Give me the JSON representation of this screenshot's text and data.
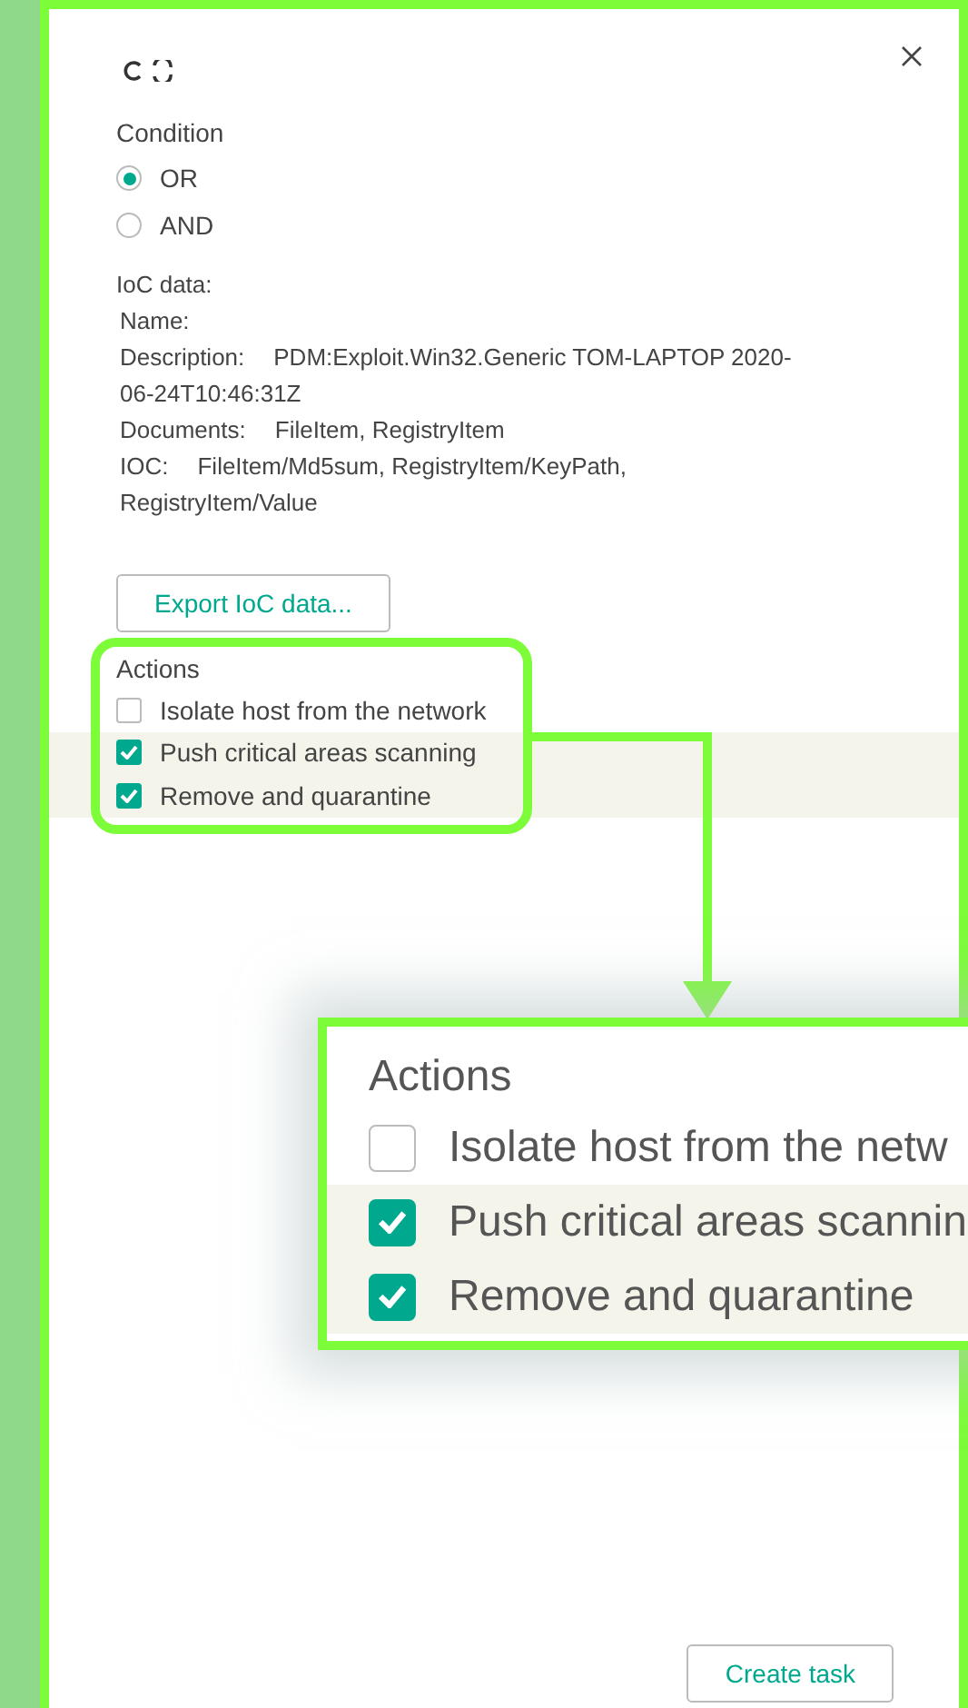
{
  "dialog": {
    "condition_label": "Condition",
    "conditions": [
      {
        "label": "OR",
        "selected": true
      },
      {
        "label": "AND",
        "selected": false
      }
    ],
    "ioc_title": "IoC data:",
    "ioc_fields": [
      {
        "label": "Name:"
      },
      {
        "label": "Description:",
        "value": "PDM:Exploit.Win32.Generic TOM-LAPTOP 2020-06-24T10:46:31Z"
      },
      {
        "label": "Documents:",
        "value": "FileItem, RegistryItem"
      },
      {
        "label": "IOC:",
        "value": "FileItem/Md5sum, RegistryItem/KeyPath, RegistryItem/Value"
      }
    ],
    "export_button": "Export IoC data...",
    "actions_label": "Actions",
    "actions": [
      {
        "label": "Isolate host from the network",
        "checked": false,
        "highlighted": false
      },
      {
        "label": "Push critical areas scanning",
        "checked": true,
        "highlighted": true
      },
      {
        "label": "Remove and quarantine",
        "checked": true,
        "highlighted": true
      }
    ],
    "create_button": "Create task"
  },
  "zoom_inset": {
    "title": "Actions",
    "items": [
      {
        "label": "Isolate host from the netw",
        "checked": false,
        "highlighted": false
      },
      {
        "label": "Push critical areas scannin",
        "checked": true,
        "highlighted": true
      },
      {
        "label": "Remove and quarantine",
        "checked": true,
        "highlighted": true
      }
    ]
  }
}
